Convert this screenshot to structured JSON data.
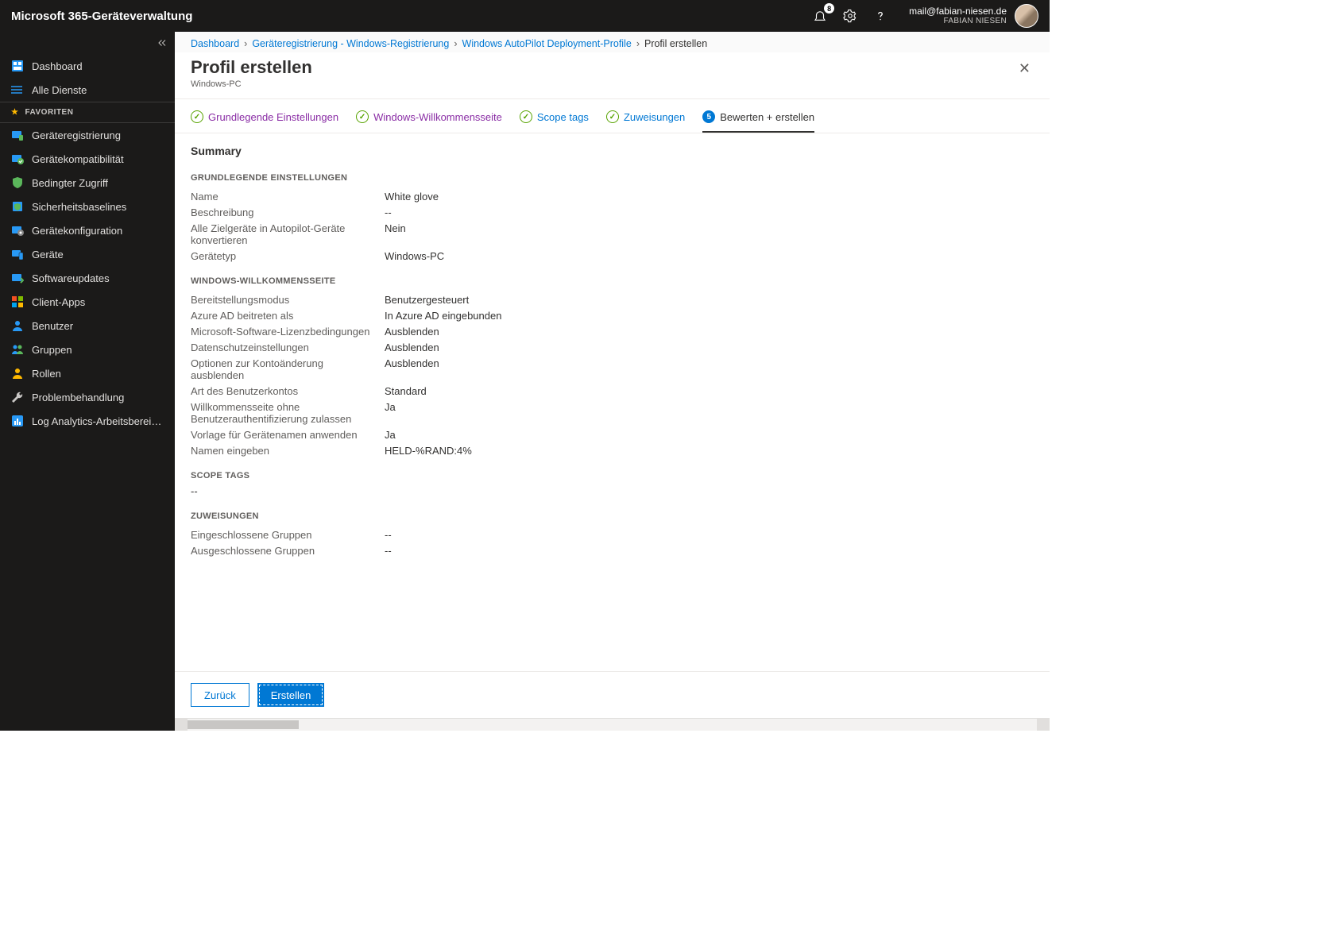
{
  "topbar": {
    "title": "Microsoft 365-Geräteverwaltung",
    "notification_count": "8",
    "user_email": "mail@fabian-niesen.de",
    "user_name": "FABIAN NIESEN"
  },
  "sidebar": {
    "dashboard": "Dashboard",
    "all_services": "Alle Dienste",
    "favorites_label": "FAVORITEN",
    "items": [
      "Geräteregistrierung",
      "Gerätekompatibilität",
      "Bedingter Zugriff",
      "Sicherheitsbaselines",
      "Gerätekonfiguration",
      "Geräte",
      "Softwareupdates",
      "Client-Apps",
      "Benutzer",
      "Gruppen",
      "Rollen",
      "Problembehandlung",
      "Log Analytics-Arbeitsbereic..."
    ]
  },
  "breadcrumbs": {
    "items": [
      "Dashboard",
      "Geräteregistrierung - Windows-Registrierung",
      "Windows AutoPilot Deployment-Profile"
    ],
    "current": "Profil erstellen"
  },
  "page": {
    "title": "Profil erstellen",
    "subtitle": "Windows-PC"
  },
  "tabs": {
    "t1": "Grundlegende Einstellungen",
    "t2": "Windows-Willkommensseite",
    "t3": "Scope tags",
    "t4": "Zuweisungen",
    "t5_num": "5",
    "t5": "Bewerten + erstellen"
  },
  "summary": {
    "heading": "Summary",
    "section1_title": "GRUNDLEGENDE EINSTELLUNGEN",
    "s1": [
      {
        "k": "Name",
        "v": "White glove"
      },
      {
        "k": "Beschreibung",
        "v": "--"
      },
      {
        "k": "Alle Zielgeräte in Autopilot-Geräte konvertieren",
        "v": "Nein"
      },
      {
        "k": "Gerätetyp",
        "v": "Windows-PC"
      }
    ],
    "section2_title": "WINDOWS-WILLKOMMENSSEITE",
    "s2": [
      {
        "k": "Bereitstellungsmodus",
        "v": "Benutzergesteuert"
      },
      {
        "k": "Azure AD beitreten als",
        "v": "In Azure AD eingebunden"
      },
      {
        "k": "Microsoft-Software-Lizenzbedingungen",
        "v": "Ausblenden"
      },
      {
        "k": "Datenschutzeinstellungen",
        "v": "Ausblenden"
      },
      {
        "k": "Optionen zur Kontoänderung ausblenden",
        "v": "Ausblenden"
      },
      {
        "k": "Art des Benutzerkontos",
        "v": "Standard"
      },
      {
        "k": "Willkommensseite ohne Benutzerauthentifizierung zulassen",
        "v": "Ja"
      },
      {
        "k": "Vorlage für Gerätenamen anwenden",
        "v": "Ja"
      },
      {
        "k": "Namen eingeben",
        "v": "HELD-%RAND:4%"
      }
    ],
    "section3_title": "SCOPE TAGS",
    "scope_tags_value": "--",
    "section4_title": "ZUWEISUNGEN",
    "s4": [
      {
        "k": "Eingeschlossene Gruppen",
        "v": "--"
      },
      {
        "k": "Ausgeschlossene Gruppen",
        "v": "--"
      }
    ]
  },
  "footer": {
    "back": "Zurück",
    "create": "Erstellen"
  }
}
